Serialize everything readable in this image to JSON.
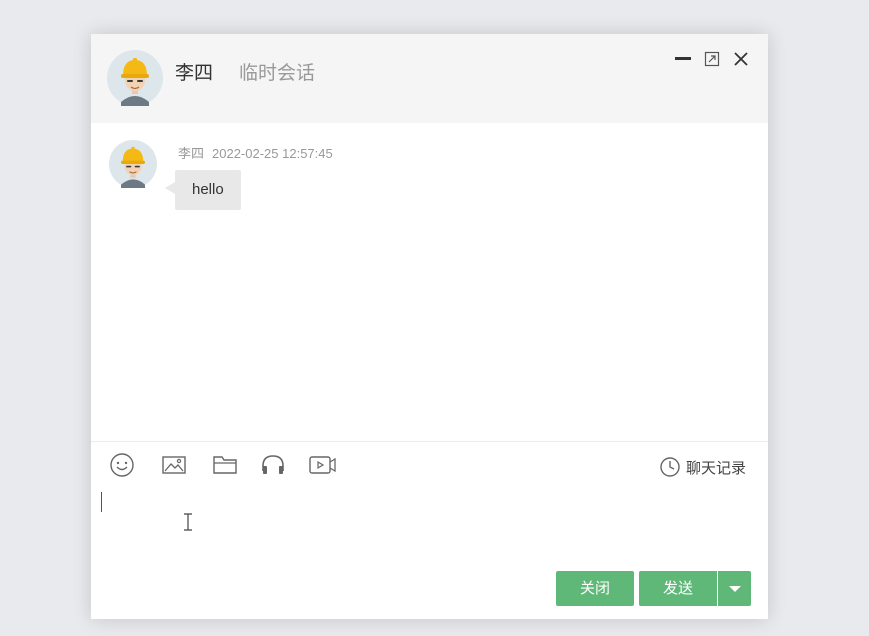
{
  "header": {
    "name": "李四",
    "status": "临时会话",
    "avatar_icon": "worker-hardhat-avatar-icon",
    "controls": [
      "minimize-icon",
      "maximize-icon",
      "close-icon"
    ]
  },
  "messages": [
    {
      "sender": "李四",
      "time": "2022-02-25 12:57:45",
      "text": "hello",
      "avatar_icon": "worker-hardhat-avatar-icon"
    }
  ],
  "toolbar": {
    "tools": [
      "emoji-icon",
      "image-icon",
      "folder-icon",
      "headset-icon",
      "video-icon"
    ],
    "history_label": "聊天记录",
    "history_icon": "clock-icon"
  },
  "input": {
    "value": ""
  },
  "buttons": {
    "close_label": "关闭",
    "send_label": "发送"
  },
  "colors": {
    "accent": "#5fb878",
    "header_bg": "#f5f5f5",
    "bubble_bg": "#e8e8e8",
    "page_bg": "#e9eaee"
  }
}
